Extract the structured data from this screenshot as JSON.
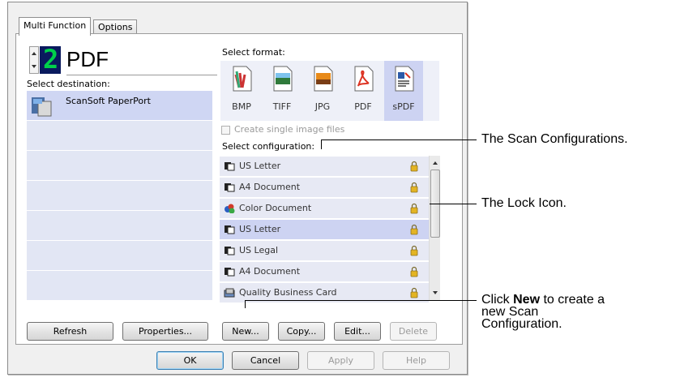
{
  "tabs": [
    "Multi Function",
    "Options"
  ],
  "counter": {
    "digit": "2",
    "format_name": "PDF"
  },
  "destination": {
    "label": "Select destination:",
    "items": [
      "ScanSoft PaperPort"
    ]
  },
  "format": {
    "label": "Select format:",
    "items": [
      {
        "name": "BMP",
        "icon": "bmp-icon"
      },
      {
        "name": "TIFF",
        "icon": "tiff-icon"
      },
      {
        "name": "JPG",
        "icon": "jpg-icon"
      },
      {
        "name": "PDF",
        "icon": "pdf-icon"
      },
      {
        "name": "sPDF",
        "icon": "spdf-icon",
        "selected": true
      }
    ],
    "single_image_checkbox": "Create single image files"
  },
  "configuration": {
    "label": "Select configuration:",
    "items": [
      {
        "name": "US Letter",
        "icon": "bw-document-icon",
        "locked": true
      },
      {
        "name": "A4 Document",
        "icon": "bw-document-icon",
        "locked": true
      },
      {
        "name": "Color Document",
        "icon": "color-document-icon",
        "locked": true
      },
      {
        "name": "US Letter",
        "icon": "bw-document-icon",
        "locked": true,
        "selected": true
      },
      {
        "name": "US Legal",
        "icon": "bw-document-icon",
        "locked": true
      },
      {
        "name": "A4 Document",
        "icon": "bw-document-icon",
        "locked": true
      },
      {
        "name": "Quality Business Card",
        "icon": "business-card-icon",
        "locked": true
      }
    ]
  },
  "buttons": {
    "refresh": "Refresh",
    "properties": "Properties...",
    "new": "New...",
    "copy": "Copy...",
    "edit": "Edit...",
    "delete": "Delete",
    "ok": "OK",
    "cancel": "Cancel",
    "apply": "Apply",
    "help": "Help"
  },
  "callouts": {
    "scan_configs": "The Scan Configurations.",
    "lock_icon": "The Lock Icon.",
    "new_prefix": "Click ",
    "new_bold": "New",
    "new_suffix": " to create a",
    "new_line2": "new Scan",
    "new_line3": "Configuration."
  },
  "colors": {
    "selection": "#cdd3f2",
    "row": "#e7e9f4",
    "digit": "#00d04a",
    "lock": "#e3b423"
  }
}
